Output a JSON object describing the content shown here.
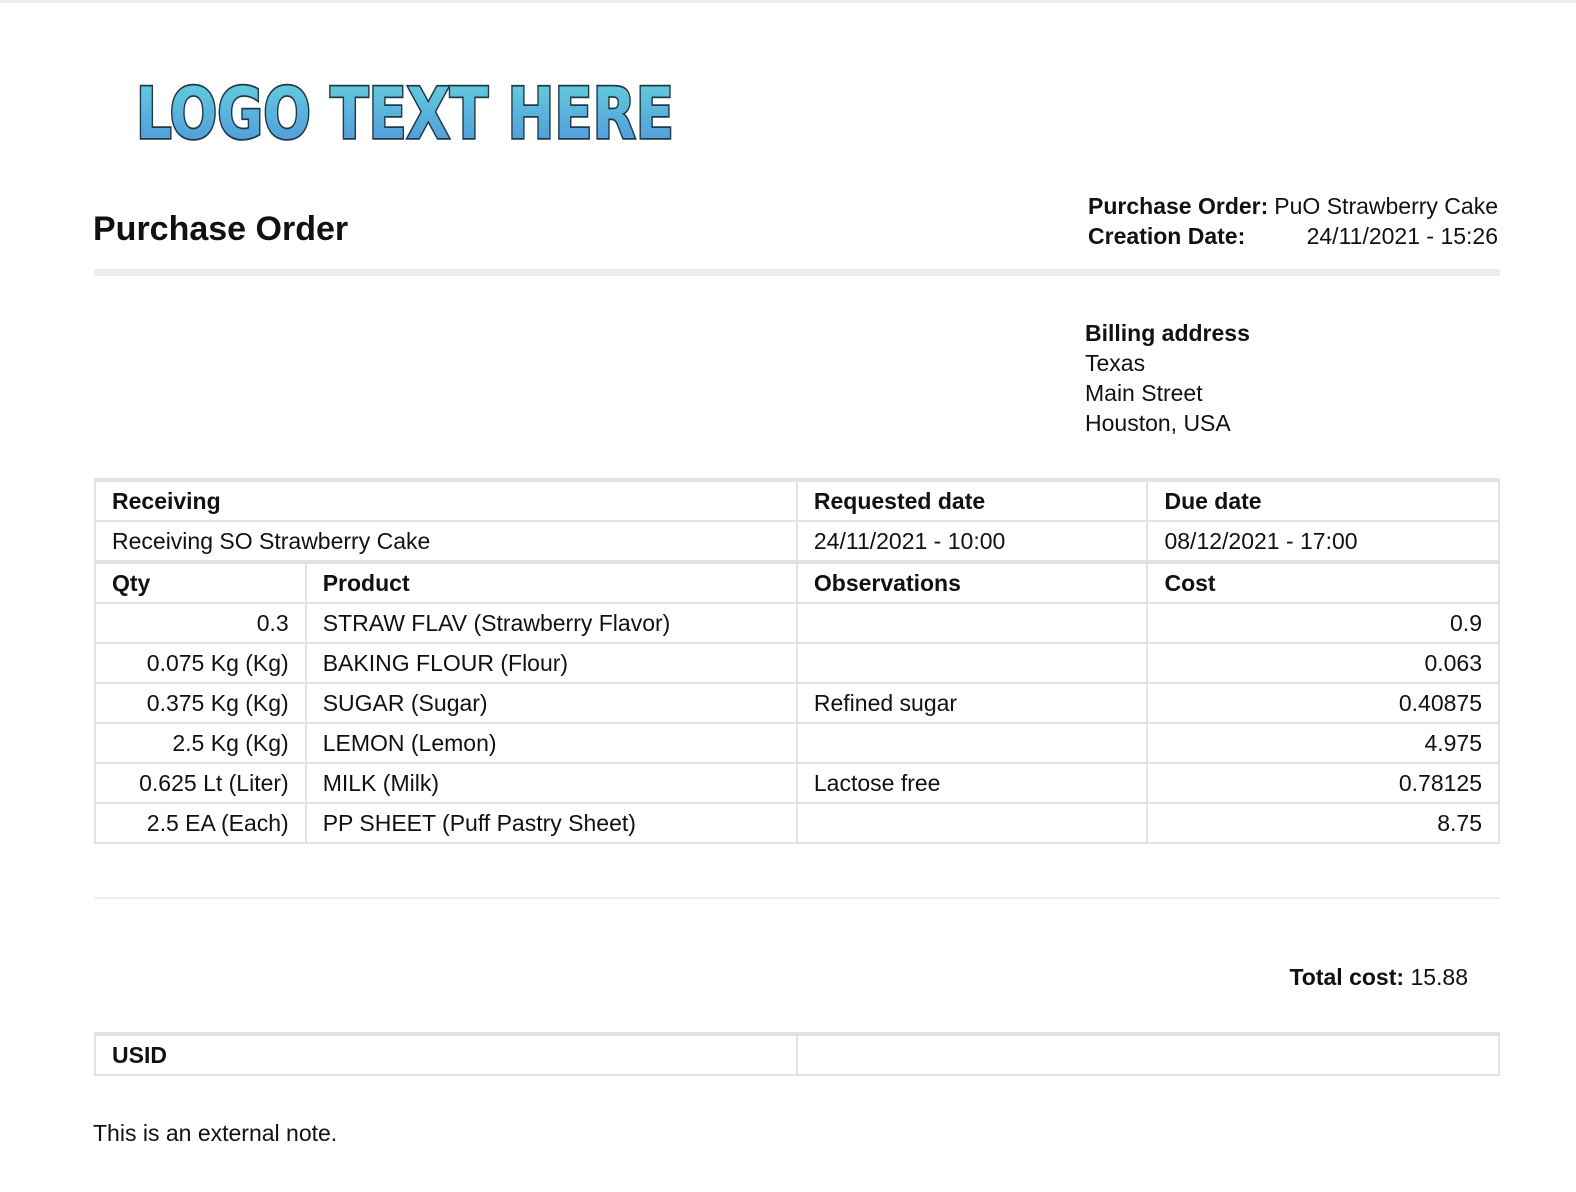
{
  "logo_text": "LOGO TEXT HERE",
  "title": "Purchase Order",
  "meta": {
    "po_label": "Purchase Order:",
    "po_value": "PuO Strawberry Cake",
    "date_label": "Creation Date:",
    "date_value": "24/11/2021 - 15:26"
  },
  "billing": {
    "heading": "Billing address",
    "lines": [
      "Texas",
      "Main Street",
      "Houston, USA"
    ]
  },
  "receiving": {
    "headers": [
      "Receiving",
      "Requested date",
      "Due date"
    ],
    "values": [
      "Receiving SO Strawberry Cake",
      "24/11/2021 - 10:00",
      "08/12/2021 - 17:00"
    ]
  },
  "items": {
    "headers": [
      "Qty",
      "Product",
      "Observations",
      "Cost"
    ],
    "rows": [
      [
        "0.3",
        "STRAW FLAV (Strawberry Flavor)",
        "",
        "0.9"
      ],
      [
        "0.075 Kg (Kg)",
        "BAKING FLOUR (Flour)",
        "",
        "0.063"
      ],
      [
        "0.375 Kg (Kg)",
        "SUGAR (Sugar)",
        "Refined sugar",
        "0.40875"
      ],
      [
        "2.5 Kg (Kg)",
        "LEMON (Lemon)",
        "",
        "4.975"
      ],
      [
        "0.625 Lt (Liter)",
        "MILK (Milk)",
        "Lactose free",
        "0.78125"
      ],
      [
        "2.5 EA (Each)",
        "PP SHEET (Puff Pastry Sheet)",
        "",
        "8.75"
      ]
    ]
  },
  "total": {
    "label": "Total cost:",
    "value": "15.88"
  },
  "usid": {
    "label": "USID",
    "value": ""
  },
  "note": "This is an external note."
}
